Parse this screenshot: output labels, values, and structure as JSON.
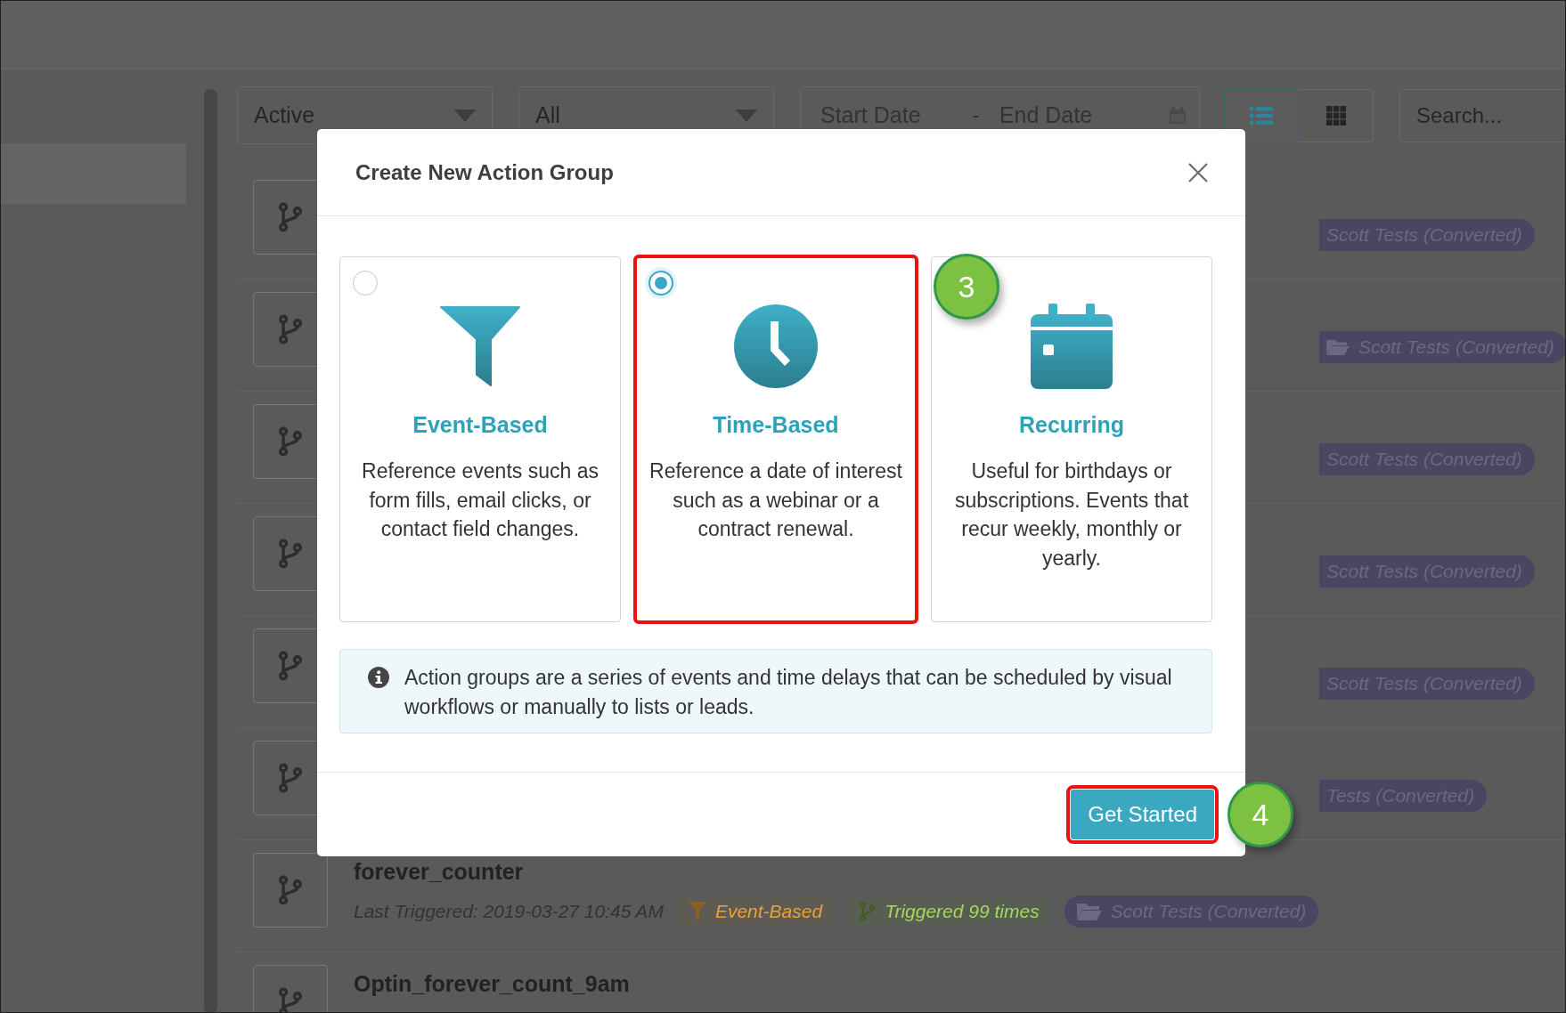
{
  "filters": {
    "status": {
      "value": "Active"
    },
    "type": {
      "value": "All"
    },
    "date_range": {
      "start_placeholder": "Start Date",
      "separator": "-",
      "end_placeholder": "End Date"
    },
    "view_toggle": [
      {
        "kind": "list",
        "selected": true
      },
      {
        "kind": "grid",
        "selected": false
      }
    ],
    "search": {
      "placeholder": "Search..."
    }
  },
  "rows": [
    {
      "tags": [
        {
          "kind": "folder",
          "label": "Scott Tests (Converted)",
          "icon_visible": false
        }
      ]
    },
    {
      "tags": [
        {
          "kind": "folder",
          "label": "Scott Tests (Converted)",
          "icon_visible": true
        }
      ]
    },
    {
      "tags": [
        {
          "kind": "folder",
          "label": "Scott Tests (Converted)",
          "icon_visible": false
        }
      ]
    },
    {
      "tags": [
        {
          "kind": "folder",
          "label": "Scott Tests (Converted)",
          "icon_visible": false
        }
      ]
    },
    {
      "tags": [
        {
          "kind": "folder",
          "label": "Scott Tests (Converted)",
          "icon_visible": false
        }
      ]
    },
    {
      "tags": [
        {
          "kind": "folder",
          "label": "Tests (Converted)",
          "icon_visible": false
        }
      ]
    },
    {
      "title": "forever_counter",
      "last_triggered": "Last Triggered: 2019-03-27 10:45 AM",
      "tags": [
        {
          "kind": "trigger_type",
          "label": "Event-Based"
        },
        {
          "kind": "trigger_count",
          "label": "Triggered 99 times"
        },
        {
          "kind": "folder",
          "label": "Scott Tests (Converted)"
        }
      ]
    },
    {
      "title": "Optin_forever_count_9am"
    }
  ],
  "modal": {
    "title": "Create New Action Group",
    "options": [
      {
        "kind": "event",
        "title": "Event-Based",
        "description": "Reference events such as form fills, email clicks, or contact field changes.",
        "selected": false,
        "highlighted": false
      },
      {
        "kind": "time",
        "title": "Time-Based",
        "description": "Reference a date of interest such as a webinar or a contract renewal.",
        "selected": true,
        "highlighted": true
      },
      {
        "kind": "recurring",
        "title": "Recurring",
        "description": "Useful for birthdays or subscriptions. Events that recur weekly, monthly or yearly.",
        "highlighted": false,
        "callout": "3"
      }
    ],
    "info": "Action groups are a series of events and time delays that can be scheduled by visual workflows or manually to lists or leads.",
    "primary_button": {
      "label": "Get Started",
      "highlighted": true,
      "callout": "4"
    }
  }
}
